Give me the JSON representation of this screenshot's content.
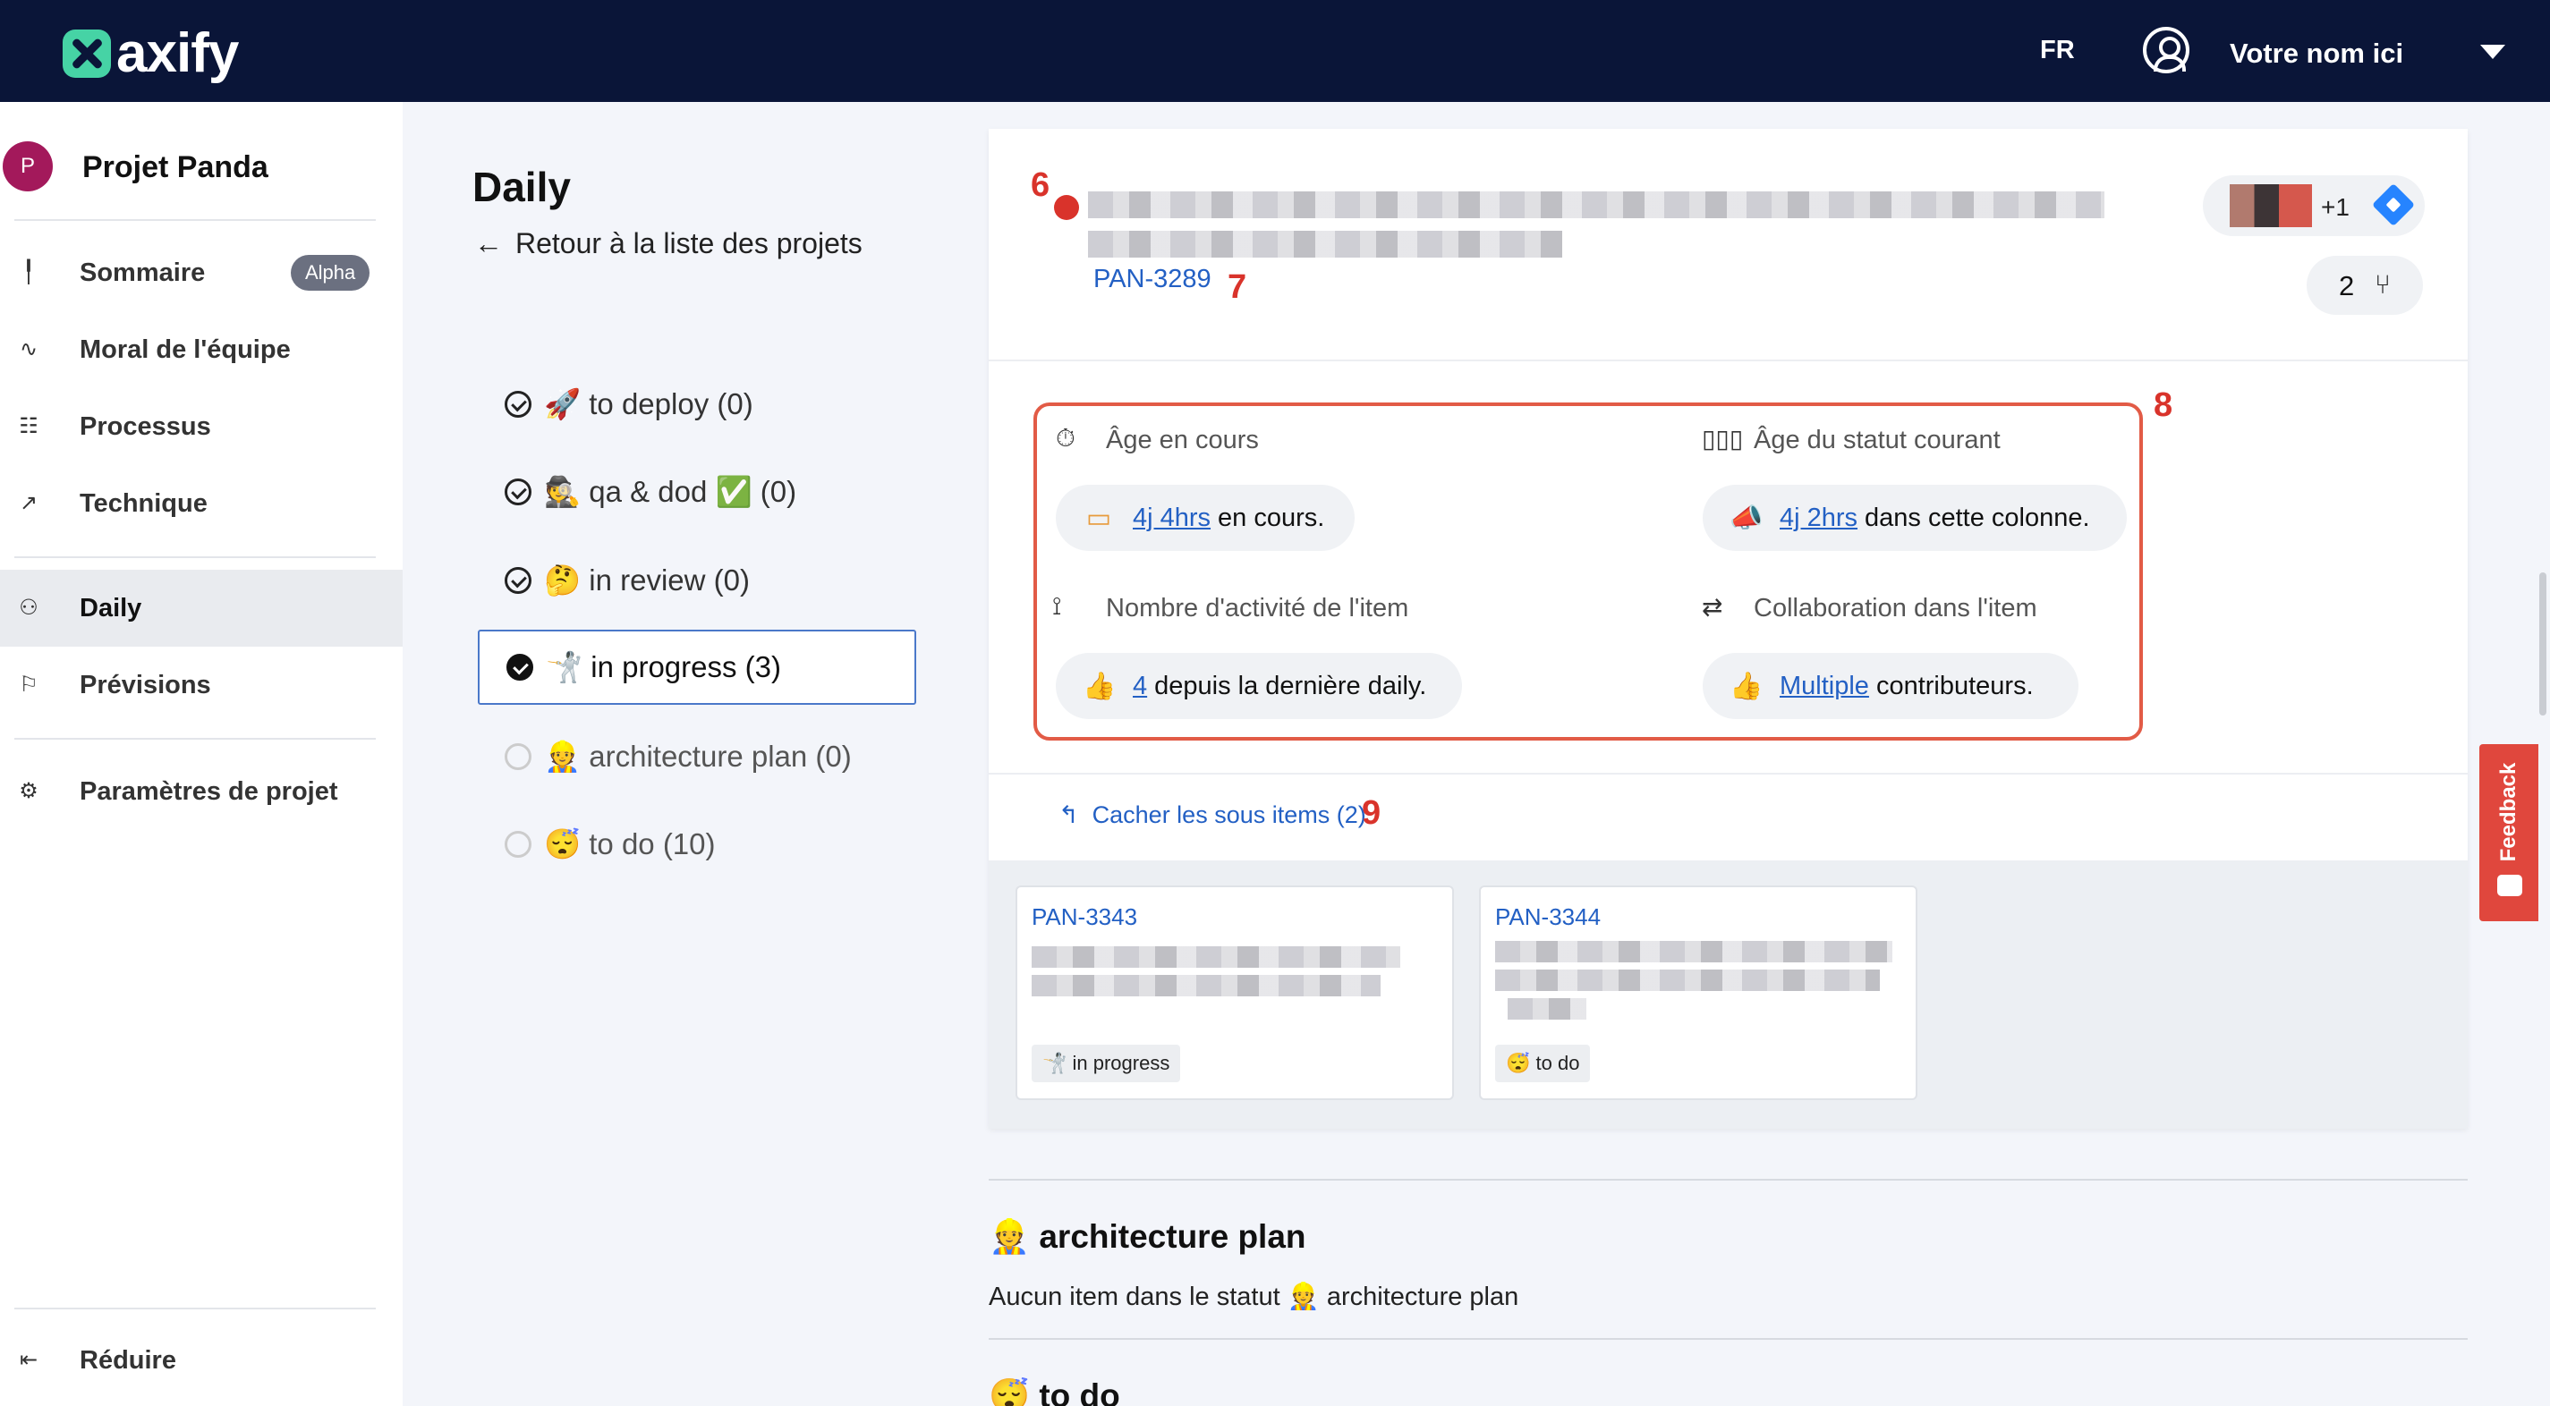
{
  "topbar": {
    "logo_text": "axify",
    "lang": "FR",
    "user_name": "Votre nom ici"
  },
  "sidebar": {
    "project_initial": "P",
    "project_name": "Projet Panda",
    "items": [
      {
        "label": "Sommaire",
        "badge": "Alpha",
        "icon": "pin-icon"
      },
      {
        "label": "Moral de l'équipe",
        "icon": "pulse-icon"
      },
      {
        "label": "Processus",
        "icon": "process-icon"
      },
      {
        "label": "Technique",
        "icon": "chart-line-icon"
      },
      {
        "label": "Daily",
        "icon": "daily-icon"
      },
      {
        "label": "Prévisions",
        "icon": "flag-icon"
      },
      {
        "label": "Paramètres de projet",
        "icon": "gear-icon"
      }
    ],
    "collapse_label": "Réduire"
  },
  "daily": {
    "title": "Daily",
    "back_label": "Retour à la liste des projets",
    "statuses": [
      {
        "label": "🚀 to deploy (0)"
      },
      {
        "label": "🕵️ qa & dod ✅ (0)"
      },
      {
        "label": "🤔 in review (0)"
      },
      {
        "label": "🤺 in progress (3)"
      },
      {
        "label": "👷 architecture plan (0)"
      },
      {
        "label": "😴 to do (10)"
      }
    ]
  },
  "item": {
    "annotation_6": "6",
    "annotation_7": "7",
    "annotation_8": "8",
    "annotation_9": "9",
    "key": "PAN-3289",
    "assignees_extra": "+1",
    "subtask_count": "2",
    "metrics": {
      "age_label": "Âge en cours",
      "age_value": "4j 4hrs",
      "age_suffix": "en cours.",
      "status_age_label": "Âge du statut courant",
      "status_age_value": "4j 2hrs",
      "status_age_suffix": "dans cette colonne.",
      "activity_label": "Nombre d'activité de l'item",
      "activity_value": "4",
      "activity_suffix": "depuis la dernière daily.",
      "collab_label": "Collaboration dans l'item",
      "collab_value": "Multiple",
      "collab_suffix": "contributeurs."
    },
    "hide_subitems": "Cacher les sous items (2)",
    "subitems": [
      {
        "key": "PAN-3343",
        "status": "🤺 in progress"
      },
      {
        "key": "PAN-3344",
        "status": "😴 to do"
      }
    ]
  },
  "sections": [
    {
      "title": "👷 architecture plan",
      "empty_text": "Aucun item dans le statut 👷 architecture plan"
    },
    {
      "title": "😴 to do"
    }
  ],
  "feedback_label": "Feedback",
  "colors": {
    "topbar": "#0a1538",
    "accent_link": "#2360c4",
    "annotation_red": "#d9332b",
    "logo_green": "#46d3a5"
  }
}
